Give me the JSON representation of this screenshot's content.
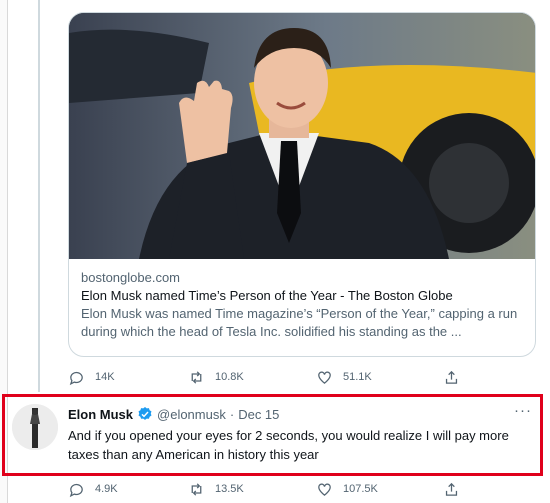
{
  "card": {
    "domain": "bostonglobe.com",
    "title": "Elon Musk named Time’s Person of the Year - The Boston Globe",
    "description": "Elon Musk was named Time magazine’s “Person of the Year,” capping a run during which the head of Tesla Inc. solidified his standing as the ..."
  },
  "first_tweet_actions": {
    "replies": "14K",
    "retweets": "10.8K",
    "likes": "51.1K"
  },
  "tweet": {
    "author_name": "Elon Musk",
    "handle": "@elonmusk",
    "separator": "·",
    "date": "Dec 15",
    "more": "···",
    "text": "And if you opened your eyes for 2 seconds, you would realize I will pay more taxes than any American in history this year"
  },
  "second_tweet_actions": {
    "replies": "4.9K",
    "retweets": "13.5K",
    "likes": "107.5K"
  },
  "colors": {
    "highlight_border": "#e0001b",
    "verified_badge": "#1d9bf0",
    "secondary_text": "#536471"
  },
  "icons": [
    "reply-icon",
    "retweet-icon",
    "like-icon",
    "share-icon",
    "verified-badge-icon",
    "more-icon"
  ]
}
